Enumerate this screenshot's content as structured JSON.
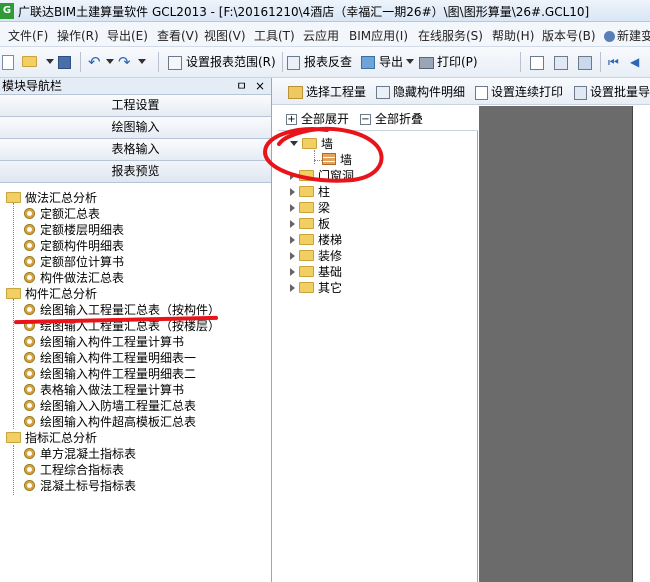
{
  "window": {
    "title": "广联达BIM土建算量软件 GCL2013 - [F:\\20161210\\4酒店（幸福汇一期26#）\\图\\图形算量\\26#.GCL10]",
    "app_icon_text": "G"
  },
  "menu": [
    "文件(F)",
    "操作(R)",
    "导出(E)",
    "查看(V)",
    "视图(V)",
    "工具(T)",
    "云应用",
    "BIM应用(I)",
    "在线服务(S)",
    "帮助(H)",
    "版本号(B)",
    "新建变更"
  ],
  "toolbar": {
    "set_range": "设置报表范围(R)",
    "report_check": "报表反查",
    "export": "导出",
    "print": "打印(P)"
  },
  "left_panel": {
    "title": "模块导航栏",
    "pin": "ㅁ",
    "close": "×",
    "modules": [
      "工程设置",
      "绘图输入",
      "表格输入",
      "报表预览"
    ],
    "tree": [
      {
        "label": "做法汇总分析",
        "type": "folder",
        "level": 0
      },
      {
        "label": "定额汇总表",
        "type": "leaf",
        "level": 1
      },
      {
        "label": "定额楼层明细表",
        "type": "leaf",
        "level": 1
      },
      {
        "label": "定额构件明细表",
        "type": "leaf",
        "level": 1
      },
      {
        "label": "定额部位计算书",
        "type": "leaf",
        "level": 1
      },
      {
        "label": "构件做法汇总表",
        "type": "leaf",
        "level": 1
      },
      {
        "label": "构件汇总分析",
        "type": "folder",
        "level": 0
      },
      {
        "label": "绘图输入工程量汇总表（按构件）",
        "type": "leaf",
        "level": 1
      },
      {
        "label": "绘图输入工程量汇总表（按楼层）",
        "type": "leaf",
        "level": 1
      },
      {
        "label": "绘图输入构件工程量计算书",
        "type": "leaf",
        "level": 1
      },
      {
        "label": "绘图输入构件工程量明细表一",
        "type": "leaf",
        "level": 1
      },
      {
        "label": "绘图输入构件工程量明细表二",
        "type": "leaf",
        "level": 1
      },
      {
        "label": "表格输入做法工程量计算书",
        "type": "leaf",
        "level": 1
      },
      {
        "label": "绘图输入入防墙工程量汇总表",
        "type": "leaf",
        "level": 1
      },
      {
        "label": "绘图输入构件超高模板汇总表",
        "type": "leaf",
        "level": 1
      },
      {
        "label": "指标汇总分析",
        "type": "folder",
        "level": 0
      },
      {
        "label": "单方混凝土指标表",
        "type": "leaf",
        "level": 1
      },
      {
        "label": "工程综合指标表",
        "type": "leaf",
        "level": 1
      },
      {
        "label": "混凝土标号指标表",
        "type": "leaf",
        "level": 1
      }
    ]
  },
  "mid_toolbar": {
    "select_project": "选择工程量",
    "hide_detail": "隐藏构件明细",
    "set_continuous_print": "设置连续打印",
    "set_batch": "设置批量导"
  },
  "expand_bar": {
    "expand_all": "全部展开",
    "collapse_all": "全部折叠"
  },
  "component_tree": [
    {
      "label": "墙",
      "expanded": true
    },
    {
      "label": "墙",
      "child": true
    },
    {
      "label": "门窗洞"
    },
    {
      "label": "柱"
    },
    {
      "label": "梁"
    },
    {
      "label": "板"
    },
    {
      "label": "楼梯"
    },
    {
      "label": "装修"
    },
    {
      "label": "基础"
    },
    {
      "label": "其它"
    }
  ],
  "annotations": {
    "color": "#e8141a"
  }
}
